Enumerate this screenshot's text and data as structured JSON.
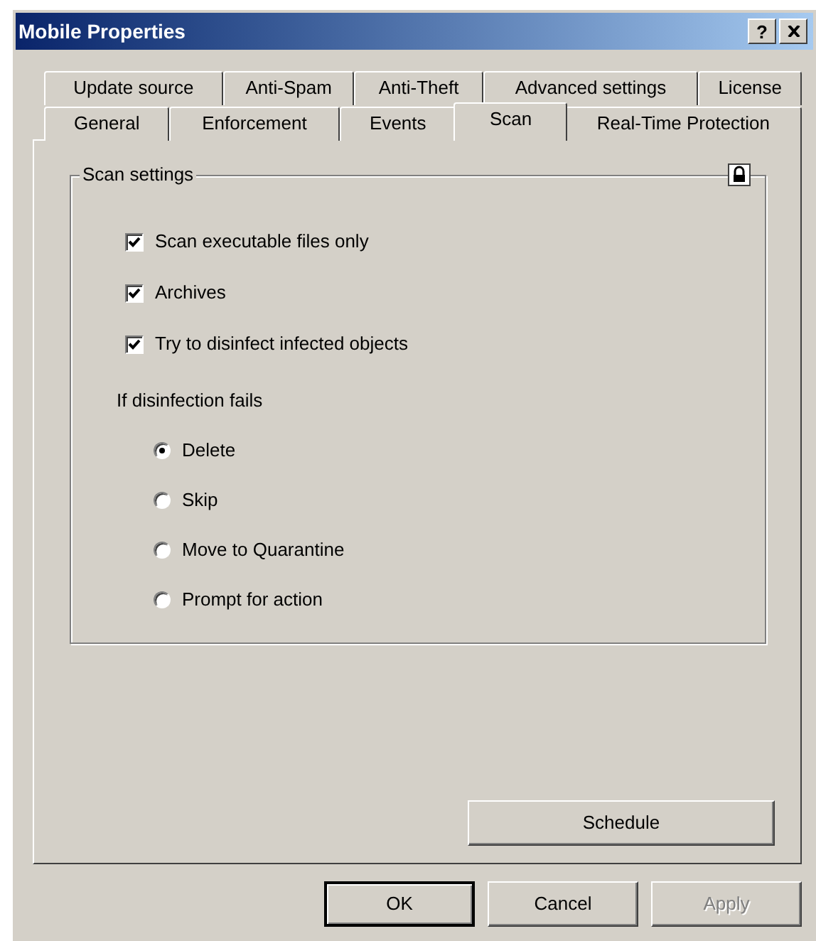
{
  "window": {
    "title": "Mobile Properties",
    "help_button": "?"
  },
  "tab_rows": [
    {
      "tabs": [
        {
          "label": "Update source",
          "selected": false
        },
        {
          "label": "Anti-Spam",
          "selected": false
        },
        {
          "label": "Anti-Theft",
          "selected": false
        },
        {
          "label": "Advanced settings",
          "selected": false
        },
        {
          "label": "License",
          "selected": false
        }
      ]
    },
    {
      "tabs": [
        {
          "label": "General",
          "selected": false
        },
        {
          "label": "Enforcement",
          "selected": false
        },
        {
          "label": "Events",
          "selected": false
        },
        {
          "label": "Scan",
          "selected": true
        },
        {
          "label": "Real-Time Protection",
          "selected": false
        }
      ]
    }
  ],
  "group": {
    "title": "Scan settings",
    "locked": true,
    "checkboxes": [
      {
        "label": "Scan executable files only",
        "checked": true
      },
      {
        "label": "Archives",
        "checked": true
      },
      {
        "label": "Try to disinfect infected objects",
        "checked": true
      }
    ],
    "radio_heading": "If disinfection fails",
    "radios": [
      {
        "label": "Delete",
        "selected": true
      },
      {
        "label": "Skip",
        "selected": false
      },
      {
        "label": "Move to Quarantine",
        "selected": false
      },
      {
        "label": "Prompt for action",
        "selected": false
      }
    ]
  },
  "schedule_button": {
    "label": "Schedule"
  },
  "buttons": [
    {
      "label": "OK",
      "default": true,
      "disabled": false
    },
    {
      "label": "Cancel",
      "default": false,
      "disabled": false
    },
    {
      "label": "Apply",
      "default": false,
      "disabled": true
    }
  ]
}
